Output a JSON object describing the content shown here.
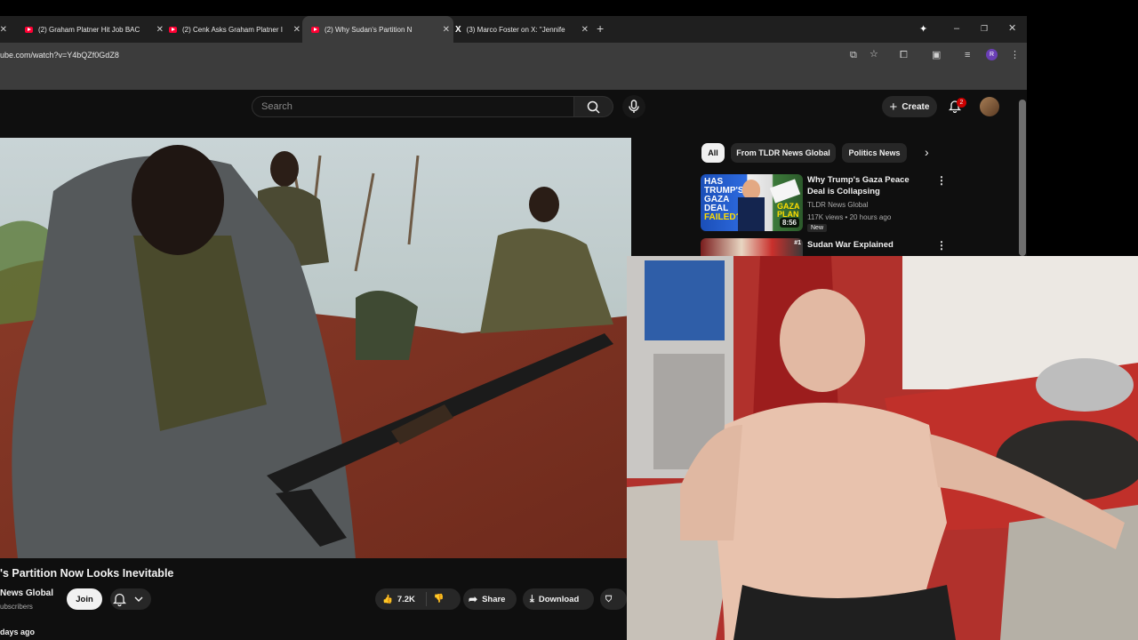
{
  "browser": {
    "tabs": [
      {
        "title": "(2) Graham Platner Hit Job BAC",
        "favicon": "youtube-icon",
        "active": false
      },
      {
        "title": "(2) Cenk Asks Graham Platner I",
        "favicon": "youtube-icon",
        "active": false
      },
      {
        "title": "(2) Why Sudan's Partition N",
        "favicon": "youtube-icon",
        "active": true
      },
      {
        "title": "(3) Marco Foster on X: \"Jennife",
        "favicon": "x-icon",
        "active": false
      }
    ],
    "new_tab": "+",
    "url": "ube.com/watch?v=Y4bQZf0GdZ8",
    "profile_initial": "R"
  },
  "header": {
    "search_placeholder": "Search",
    "create_label": "Create",
    "notification_count": "2"
  },
  "chips": [
    "All",
    "From TLDR News Global",
    "Politics News"
  ],
  "sidebar": {
    "cards": [
      {
        "title": "Why Trump's Gaza Peace Deal is Collapsing",
        "channel": "TLDR News Global",
        "meta": "117K views • 20 hours ago",
        "badge": "New",
        "duration": "8:56",
        "thumb_text_1": "HAS",
        "thumb_text_2": "TRUMP'S",
        "thumb_text_3": "GAZA",
        "thumb_text_4": "DEAL",
        "thumb_text_5": "FAILED?",
        "thumb_text_6": "GAZA",
        "thumb_text_7": "PLAN"
      },
      {
        "title": "Sudan War Explained",
        "channel": "",
        "meta": ""
      }
    ]
  },
  "video": {
    "title": "'s Partition Now Looks Inevitable",
    "channel": "News Global",
    "subscribers": "ubscribers",
    "join_label": "Join",
    "likes": "7.2K",
    "share_label": "Share",
    "download_label": "Download",
    "date": "days ago"
  },
  "colors": {
    "accent": "#ff0033",
    "background": "#0f0f0f",
    "chip": "#272727"
  }
}
